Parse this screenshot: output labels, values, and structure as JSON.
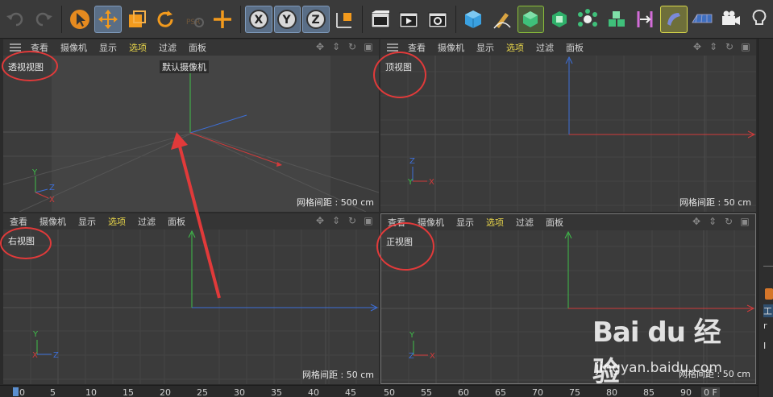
{
  "toolbar": {
    "icons": [
      "undo-icon",
      "redo-icon",
      "select-arrow-icon",
      "move-icon",
      "scale-icon",
      "rotate-icon",
      "psr-icon",
      "recent-tool-icon",
      "lock-x-icon",
      "lock-y-icon",
      "lock-z-icon",
      "coordinate-system-icon",
      "render-view-icon",
      "render-picture-viewer-icon",
      "render-settings-icon",
      "cube-icon",
      "pen-icon",
      "subdivision-icon",
      "extrude-icon",
      "mograph-cloner-icon",
      "array-icon",
      "bend-icon",
      "deformer-icon",
      "floor-icon",
      "camera-icon",
      "light-icon"
    ],
    "axis_labels": {
      "x": "X",
      "y": "Y",
      "z": "Z"
    }
  },
  "viewport_menu": {
    "items": [
      "查看",
      "摄像机",
      "显示",
      "选项",
      "过滤",
      "面板"
    ],
    "highlight": "选项"
  },
  "viewports": {
    "perspective": {
      "title": "透视视图",
      "camera": "默认摄像机",
      "grid": "网格间距 : 500 cm"
    },
    "top": {
      "title": "顶视图",
      "grid": "网格间距 : 50 cm"
    },
    "right": {
      "title": "右视图",
      "grid": "网格间距 : 50 cm"
    },
    "front": {
      "title": "正视图",
      "grid": "网格间距 : 50 cm"
    }
  },
  "axis_gizmo": {
    "x": "X",
    "y": "Y",
    "z": "Z"
  },
  "timeline_ruler": {
    "ticks": [
      "0",
      "5",
      "10",
      "15",
      "20",
      "25",
      "30",
      "35",
      "40",
      "45",
      "50",
      "55",
      "60",
      "65",
      "70",
      "75",
      "80",
      "85",
      "90"
    ],
    "end_value": "0 F"
  },
  "right_strip": {
    "tab1": "工",
    "tab2": "r",
    "tab3": "I"
  },
  "watermark": {
    "brand": "Bai du 经验",
    "url": "jingyan.baidu.com"
  },
  "colors": {
    "accent_highlight": "#e8d54a",
    "annotation_red": "#e13a3a",
    "axis_x": "#d23b3b",
    "axis_y": "#3fbf4a",
    "axis_z": "#3d6fd8"
  }
}
